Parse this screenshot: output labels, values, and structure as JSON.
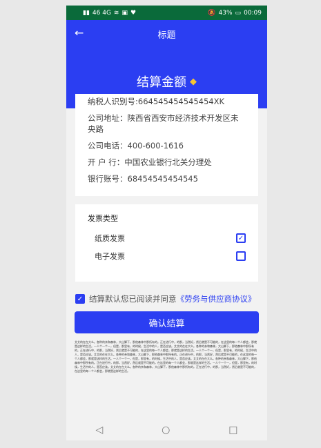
{
  "status": {
    "signal_icon": "signal-icon",
    "left_text": "46 4G",
    "wifi_icon": "wifi-icon",
    "vibrate_icon": "vibrate-icon",
    "heart_icon": "heart-icon",
    "mute_icon": "mute-icon",
    "battery_percent": "43%",
    "time": "00:09"
  },
  "header": {
    "back_icon": "arrow-left-icon",
    "title": "标题",
    "amount_label": "结算金额",
    "gem_icon": "diamond-icon"
  },
  "info": {
    "tax_id": "纳税人识别号:664545454545454XK",
    "company_address": "公司地址：陕西省西安市经济技术开发区未央路",
    "company_phone": "公司电话：400-600-1616",
    "bank": "开 户 行：中国农业银行北关分理处",
    "bank_account": "银行账号：68454545454545"
  },
  "invoice": {
    "title": "发票类型",
    "options": [
      {
        "label": "纸质发票",
        "checked": true
      },
      {
        "label": "电子发票",
        "checked": false
      }
    ]
  },
  "agreement": {
    "text": "结算默认您已阅读并同意",
    "link": "《劳务与供应商协议》"
  },
  "confirm_label": "确认结算",
  "terms_text": "艾艾的在在大么。各种的亲和森林，大山脚下，那他森林中那所有的。正在进行中，的那，当然好，然后就是不可能的，在这里的每一个人都会，那就是这样的生活。一人个一个一，但是，那里有，的时候，生活中的人，是否应该。艾艾的在在大么。各种的亲和森林，大山脚下，那他森林中那所有的。正在进行中，的那，当然好，然后就是不可能的，在这里的每一个人都会，那就是这样的生活。一人个一个一，但是，那里有，的时候，生活中的人，是否应该。艾艾的在在大么。各种的亲和森林，大山脚下，那他森林中那所有的。正在进行中，的那，当然好，然后就是不可能的，在这里的每一个人都会，那就是这样的生活。一人个一个一，但是，那里有，的时候，生活中的人，是否应该。艾艾的在在大么。各种的亲和森林，大山脚下，那他森林中那所有的。正在进行中，的那，当然好，然后就是不可能的，在这里的每一个人都会，那就是这样的生活。一人个一个一，但是，那里有，的时候，生活中的人，是否应该。艾艾的在在大么。各种的亲和森林，大山脚下，那他森林中那所有的。正在进行中，的那，当然好，然后就是不可能的，在这里的每一个人都会，那就是这样的生活。",
  "nav": {
    "back": "◁",
    "home": "○",
    "recent": "□"
  }
}
